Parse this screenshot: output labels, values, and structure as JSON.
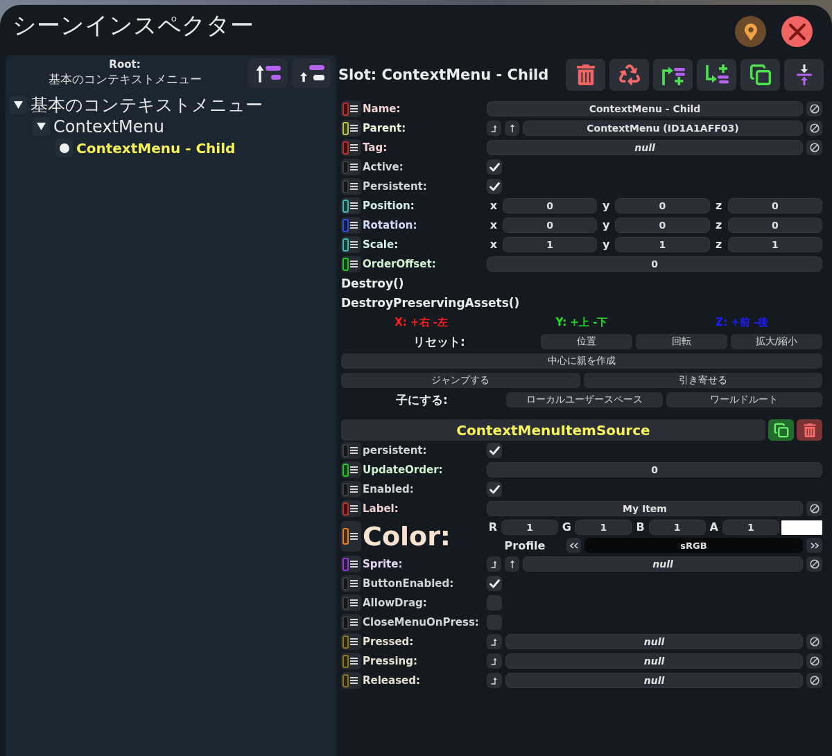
{
  "window": {
    "title": "シーンインスペクター"
  },
  "hierarchy": {
    "root_label": "Root:",
    "root_name": "基本のコンテキストメニュー",
    "tree": [
      {
        "label": "基本のコンテキストメニュー",
        "expanded": true,
        "selected": false,
        "children": [
          {
            "label": "ContextMenu",
            "expanded": true,
            "selected": false,
            "children": [
              {
                "label": "ContextMenu - Child",
                "selected": true
              }
            ]
          }
        ]
      }
    ]
  },
  "slot": {
    "title": "Slot: ContextMenu - Child",
    "fields": [
      {
        "kind": "text",
        "label": "Name:",
        "color": "#b8302c",
        "value": "ContextMenu - Child",
        "is_null": false
      },
      {
        "kind": "ref",
        "label": "Parent:",
        "color": "#b8c248",
        "value": "ContextMenu (ID1A1AFF03)",
        "is_null": false
      },
      {
        "kind": "text",
        "label": "Tag:",
        "color": "#b8302c",
        "value": "null",
        "is_null": true
      },
      {
        "kind": "checkbox",
        "label": "Active:",
        "color": "#3c3c3c",
        "checked": true
      },
      {
        "kind": "checkbox",
        "label": "Persistent:",
        "color": "#3c3c3c",
        "checked": true
      },
      {
        "kind": "vector",
        "label": "Position:",
        "color": "#3eb8b0",
        "components": [
          {
            "axis": "x",
            "value": "0"
          },
          {
            "axis": "y",
            "value": "0"
          },
          {
            "axis": "z",
            "value": "0"
          }
        ]
      },
      {
        "kind": "vector",
        "label": "Rotation:",
        "color": "#2c4ed8",
        "components": [
          {
            "axis": "x",
            "value": "0"
          },
          {
            "axis": "y",
            "value": "0"
          },
          {
            "axis": "z",
            "value": "0"
          }
        ]
      },
      {
        "kind": "vector",
        "label": "Scale:",
        "color": "#3eb8b0",
        "components": [
          {
            "axis": "x",
            "value": "1"
          },
          {
            "axis": "y",
            "value": "1"
          },
          {
            "axis": "z",
            "value": "1"
          }
        ]
      },
      {
        "kind": "number",
        "label": "OrderOffset:",
        "color": "#22c02a",
        "value": "0"
      }
    ],
    "methods": [
      "Destroy()",
      "DestroyPreservingAssets()"
    ],
    "axis_legend": [
      {
        "label": "X: +右 -左",
        "color": "#ff1c1c"
      },
      {
        "label": "Y: +上 -下",
        "color": "#22e022"
      },
      {
        "label": "Z: +前 -後",
        "color": "#1c1cff"
      }
    ],
    "reset": {
      "label": "リセット:",
      "buttons": [
        "位置",
        "回転",
        "拡大/縮小"
      ]
    },
    "center_button": "中心に親を作成",
    "move_buttons": [
      "ジャンプする",
      "引き寄せる"
    ],
    "parent_under": {
      "label": "子にする:",
      "buttons": [
        "ローカルユーザースペース",
        "ワールドルート"
      ]
    }
  },
  "components": [
    {
      "title": "ContextMenuItemSource",
      "fields": [
        {
          "kind": "checkbox",
          "label": "persistent:",
          "color": "#3c3c3c",
          "checked": true
        },
        {
          "kind": "number",
          "label": "UpdateOrder:",
          "color": "#22c02a",
          "value": "0"
        },
        {
          "kind": "checkbox",
          "label": "Enabled:",
          "color": "#3c3c3c",
          "checked": true
        },
        {
          "kind": "text",
          "label": "Label:",
          "color": "#b8302c",
          "value": "My Item",
          "is_null": false
        },
        {
          "kind": "color",
          "label": "Color:",
          "color": "#e0802c",
          "channels": [
            {
              "axis": "R",
              "value": "1"
            },
            {
              "axis": "G",
              "value": "1"
            },
            {
              "axis": "B",
              "value": "1"
            },
            {
              "axis": "A",
              "value": "1"
            }
          ],
          "swatch": {
            "color": "#ffffff"
          },
          "profile_label": "Profile",
          "profile": "sRGB"
        },
        {
          "kind": "ref",
          "label": "Sprite:",
          "color": "#8a3ccc",
          "value": "null",
          "is_null": true
        },
        {
          "kind": "checkbox",
          "label": "ButtonEnabled:",
          "color": "#3c3c3c",
          "checked": true
        },
        {
          "kind": "checkbox",
          "label": "AllowDrag:",
          "color": "#3c3c3c",
          "checked": false
        },
        {
          "kind": "checkbox",
          "label": "CloseMenuOnPress:",
          "color": "#3c3c3c",
          "checked": false
        },
        {
          "kind": "delegate",
          "label": "Pressed:",
          "color": "#8a7424",
          "value": "null",
          "is_null": true
        },
        {
          "kind": "delegate",
          "label": "Pressing:",
          "color": "#8a7424",
          "value": "null",
          "is_null": true
        },
        {
          "kind": "delegate",
          "label": "Released:",
          "color": "#8a7424",
          "value": "null",
          "is_null": true
        }
      ]
    }
  ]
}
